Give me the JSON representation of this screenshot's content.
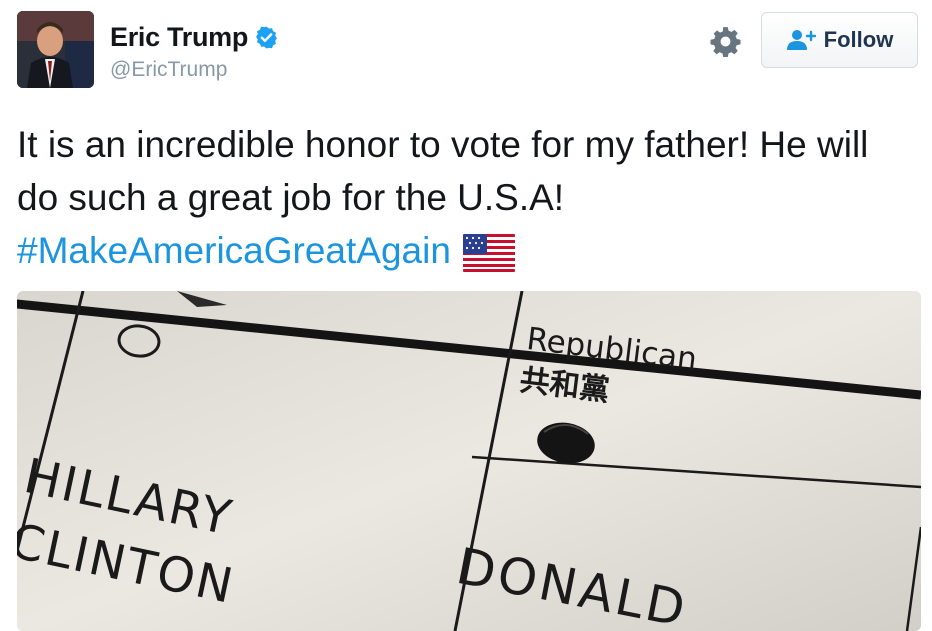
{
  "header": {
    "display_name": "Eric Trump",
    "handle": "@EricTrump",
    "verified": true,
    "follow_label": "Follow"
  },
  "tweet": {
    "text_line": "It is an incredible honor to vote for my father! He will do such a great job for the U.S.A!",
    "hashtag": "#MakeAmericaGreatAgain",
    "emoji": "us-flag"
  },
  "media": {
    "ballot_party": "Republican",
    "ballot_party_cjk": "共和黨",
    "candidate_1_first": "HILLARY",
    "candidate_1_last": "CLINTON",
    "candidate_2_first": "DONALD"
  },
  "icons": {
    "verified": "verified-badge-icon",
    "gear": "gear-icon",
    "follow": "add-user-icon",
    "flag": "us-flag-icon"
  },
  "colors": {
    "link": "#1b95e0",
    "handle": "#8899a6",
    "follow_text": "#1f3550",
    "verified": "#1da1f2"
  }
}
